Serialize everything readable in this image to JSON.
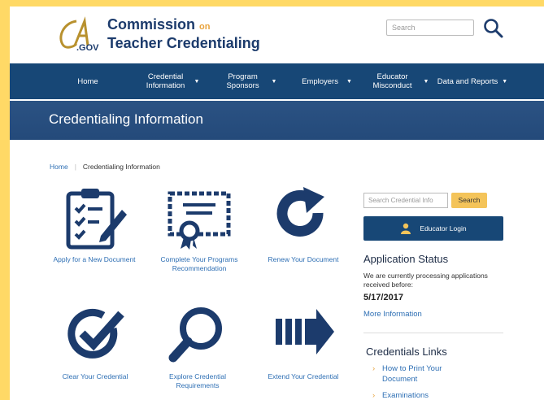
{
  "header": {
    "logo_text": "CA.GOV",
    "org_line1": "Commission",
    "org_on": "on",
    "org_line2": "Teacher Credentialing",
    "search_placeholder": "Search"
  },
  "nav": [
    {
      "label": "Home",
      "caret": false
    },
    {
      "label": "Credential Information",
      "caret": true
    },
    {
      "label": "Program Sponsors",
      "caret": true
    },
    {
      "label": "Employers",
      "caret": true
    },
    {
      "label": "Educator Misconduct",
      "caret": true
    },
    {
      "label": "Data and Reports",
      "caret": true
    }
  ],
  "banner": {
    "title": "Credentialing Information"
  },
  "breadcrumb": {
    "home": "Home",
    "current": "Credentialing Information"
  },
  "tiles": [
    {
      "label": "Apply for a New Document",
      "icon": "clipboard-checklist-icon"
    },
    {
      "label": "Complete Your Programs Recommendation",
      "icon": "certificate-icon"
    },
    {
      "label": "Renew Your Document",
      "icon": "renew-arrow-icon"
    },
    {
      "label": "Clear Your Credential",
      "icon": "check-circle-icon"
    },
    {
      "label": "Explore Credential Requirements",
      "icon": "magnifier-icon"
    },
    {
      "label": "Extend Your Credential",
      "icon": "extend-arrow-icon"
    }
  ],
  "sidebar": {
    "search_placeholder": "Search Credential Info",
    "search_button": "Search",
    "login_button": "Educator Login",
    "app_status_title": "Application Status",
    "app_status_text": "We are currently processing applications received before:",
    "app_status_date": "5/17/2017",
    "more_info": "More Information",
    "links_title": "Credentials Links",
    "links": [
      "How to Print Your Document",
      "Examinations"
    ]
  },
  "colors": {
    "navy": "#174776",
    "accent": "#f4c45a",
    "link": "#2e6fb4",
    "frame": "#ffd966"
  }
}
